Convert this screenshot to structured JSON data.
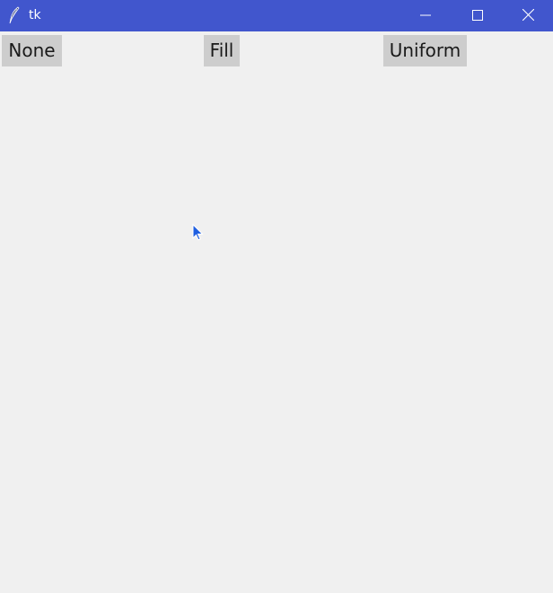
{
  "window": {
    "title": "tk",
    "titlebar_color": "#4156cd",
    "icon": "feather-icon",
    "controls": [
      "minimize-icon",
      "maximize-icon",
      "close-icon"
    ]
  },
  "buttons": {
    "none_label": "None",
    "fill_label": "Fill",
    "uniform_label": "Uniform",
    "background": "#cdcdcd"
  },
  "cursor": {
    "icon": "mouse-pointer-icon",
    "color": "#1f5fe0"
  }
}
